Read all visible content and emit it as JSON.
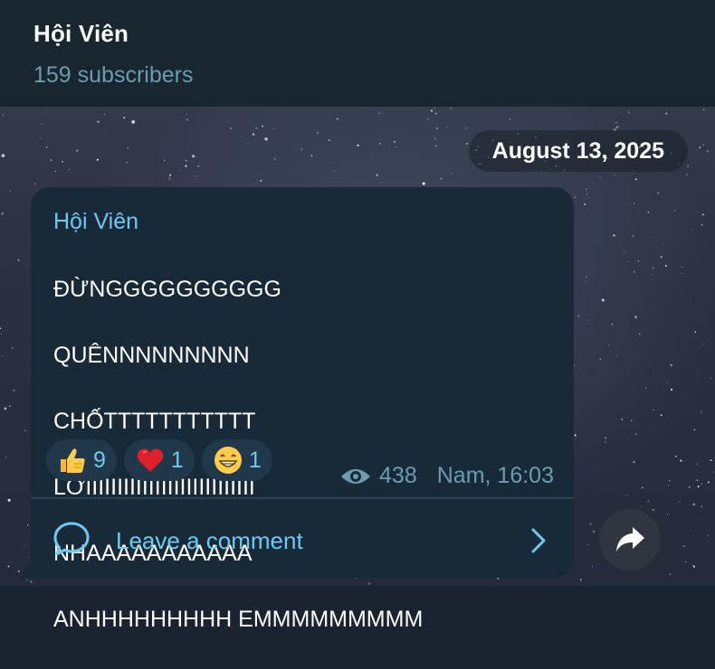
{
  "header": {
    "title": "Hội Viên",
    "subtitle": "159 subscribers"
  },
  "date_chip": "August 13, 2025",
  "message": {
    "sender": "Hội Viên",
    "lines": [
      "ĐỪNGGGGGGGGGG",
      "QUÊNNNNNNNNN",
      "CHỐTTTTTTTTTTT",
      "LỜIIIIIIIIIIIIIIIIIIIIIIIIIII",
      "NHAAAAAAAAAAA",
      "ANHHHHHHHHH EMMMMMMMMM"
    ],
    "reactions": [
      {
        "emoji": "thumbs-up",
        "count": "9"
      },
      {
        "emoji": "red-heart",
        "count": "1"
      },
      {
        "emoji": "grinning-face",
        "count": "1"
      }
    ],
    "views": "438",
    "author_time": "Nam, 16:03",
    "comment_label": "Leave a comment"
  },
  "colors": {
    "accent": "#6ec9f2",
    "bubble": "#182a38",
    "header": "#17262f",
    "muted": "#6d9bb0"
  }
}
